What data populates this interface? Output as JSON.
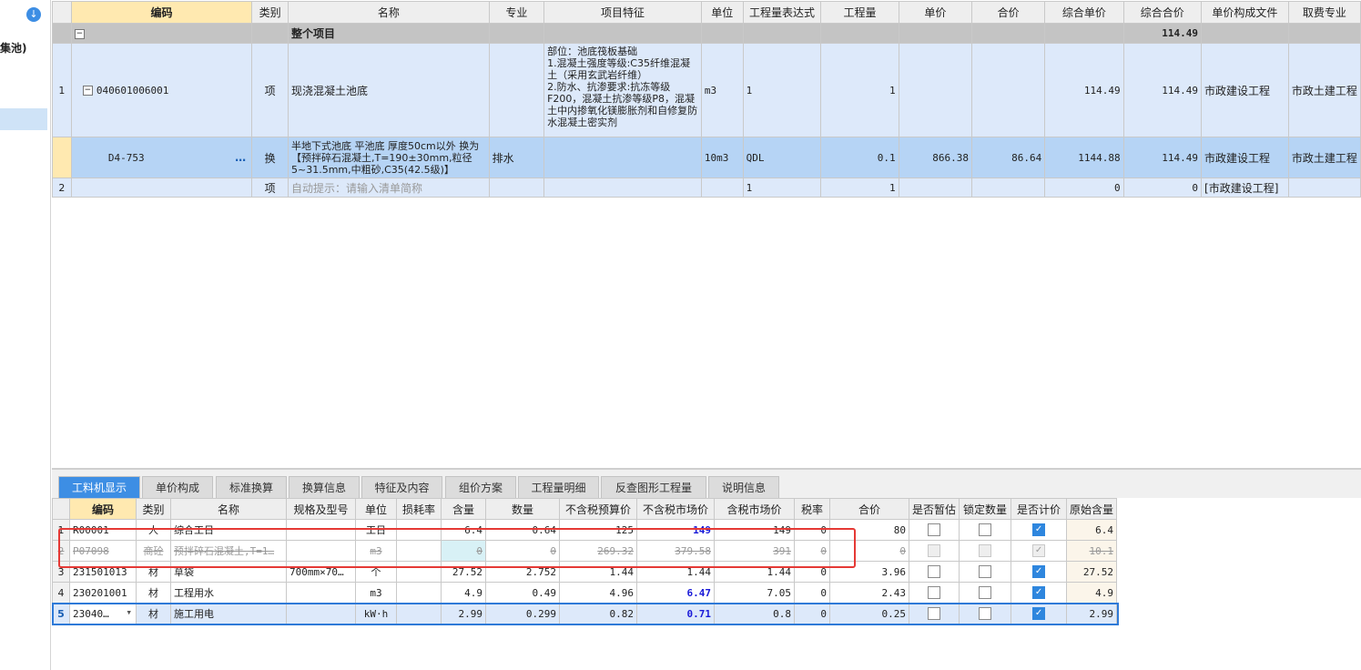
{
  "sidebar": {
    "label": "集池)",
    "icon": "download-icon"
  },
  "top_grid": {
    "headers": [
      "编码",
      "类别",
      "名称",
      "专业",
      "项目特征",
      "单位",
      "工程量表达式",
      "工程量",
      "单价",
      "合价",
      "综合单价",
      "综合合价",
      "单价构成文件",
      "取费专业"
    ],
    "project_row": {
      "expander": "−",
      "name": "整个项目",
      "total": "114.49"
    },
    "item_row": {
      "rownum": "1",
      "expander": "−",
      "code": "040601006001",
      "type": "项",
      "name": "现浇混凝土池底",
      "features": "部位：池底筏板基础\n1.混凝土强度等级:C35纤维混凝土（采用玄武岩纤维）\n2.防水、抗渗要求:抗冻等级F200，混凝土抗渗等级P8，混凝土中内掺氧化镁膨胀剂和自修复防水混凝土密实剂",
      "unit": "m3",
      "expr": "1",
      "qty": "1",
      "composite_price": "114.49",
      "composite_total": "114.49",
      "price_file": "市政建设工程",
      "fee_major": "市政土建工程"
    },
    "sub_row": {
      "code": "D4-753",
      "more": "…",
      "type": "换",
      "name": "半地下式池底 平池底 厚度50cm以外  换为【预拌碎石混凝土,T=190±30mm,粒径5~31.5mm,中粗砂,C35(42.5级)】",
      "major": "排水",
      "unit": "10m3",
      "expr": "QDL",
      "qty": "0.1",
      "price": "866.38",
      "total": "86.64",
      "composite_price": "1144.88",
      "composite_total": "114.49",
      "price_file": "市政建设工程",
      "fee_major": "市政土建工程"
    },
    "last_row": {
      "rownum": "2",
      "type": "项",
      "name": "自动提示：请输入清单简称",
      "expr": "1",
      "qty": "1",
      "composite_price": "0",
      "composite_total": "0",
      "price_file": "[市政建设工程]"
    }
  },
  "tabs": [
    "工料机显示",
    "单价构成",
    "标准换算",
    "换算信息",
    "特征及内容",
    "组价方案",
    "工程量明细",
    "反查图形工程量",
    "说明信息"
  ],
  "bottom_grid": {
    "headers": [
      "编码",
      "类别",
      "名称",
      "规格及型号",
      "单位",
      "损耗率",
      "含量",
      "数量",
      "不含税预算价",
      "不含税市场价",
      "含税市场价",
      "税率",
      "合价",
      "是否暂估",
      "锁定数量",
      "是否计价",
      "原始含量"
    ],
    "rows": [
      {
        "rownum": "1",
        "code": "R00001",
        "type": "人",
        "name": "综合工日",
        "spec": "",
        "unit": "工日",
        "loss": "",
        "content": "6.4",
        "qty": "0.64",
        "budget": "125",
        "market": "149",
        "market_tax": "149",
        "tax": "0",
        "total": "80",
        "orig": "6.4"
      },
      {
        "rownum": "2",
        "code": "P07098",
        "type": "商砼",
        "name": "预拌碎石混凝土,T=1…",
        "spec": "",
        "unit": "m3",
        "loss": "",
        "content": "0",
        "qty": "0",
        "budget": "269.32",
        "market": "379.58",
        "market_tax": "391",
        "tax": "0",
        "total": "0",
        "orig": "10.1"
      },
      {
        "rownum": "3",
        "code": "231501013",
        "type": "材",
        "name": "草袋",
        "spec": "700mm×70…",
        "unit": "个",
        "loss": "",
        "content": "27.52",
        "qty": "2.752",
        "budget": "1.44",
        "market": "1.44",
        "market_tax": "1.44",
        "tax": "0",
        "total": "3.96",
        "orig": "27.52"
      },
      {
        "rownum": "4",
        "code": "230201001",
        "type": "材",
        "name": "工程用水",
        "spec": "",
        "unit": "m3",
        "loss": "",
        "content": "4.9",
        "qty": "0.49",
        "budget": "4.96",
        "market": "6.47",
        "market_tax": "7.05",
        "tax": "0",
        "total": "2.43",
        "orig": "4.9"
      },
      {
        "rownum": "5",
        "code": "23040…",
        "type": "材",
        "name": "施工用电",
        "spec": "",
        "unit": "kW·h",
        "loss": "",
        "content": "2.99",
        "qty": "0.299",
        "budget": "0.82",
        "market": "0.71",
        "market_tax": "0.8",
        "tax": "0",
        "total": "0.25",
        "orig": "2.99"
      }
    ]
  },
  "colors": {
    "accent": "#3d8ee4",
    "highlight_box": "#e53935",
    "header_highlight": "#ffe9b0"
  }
}
